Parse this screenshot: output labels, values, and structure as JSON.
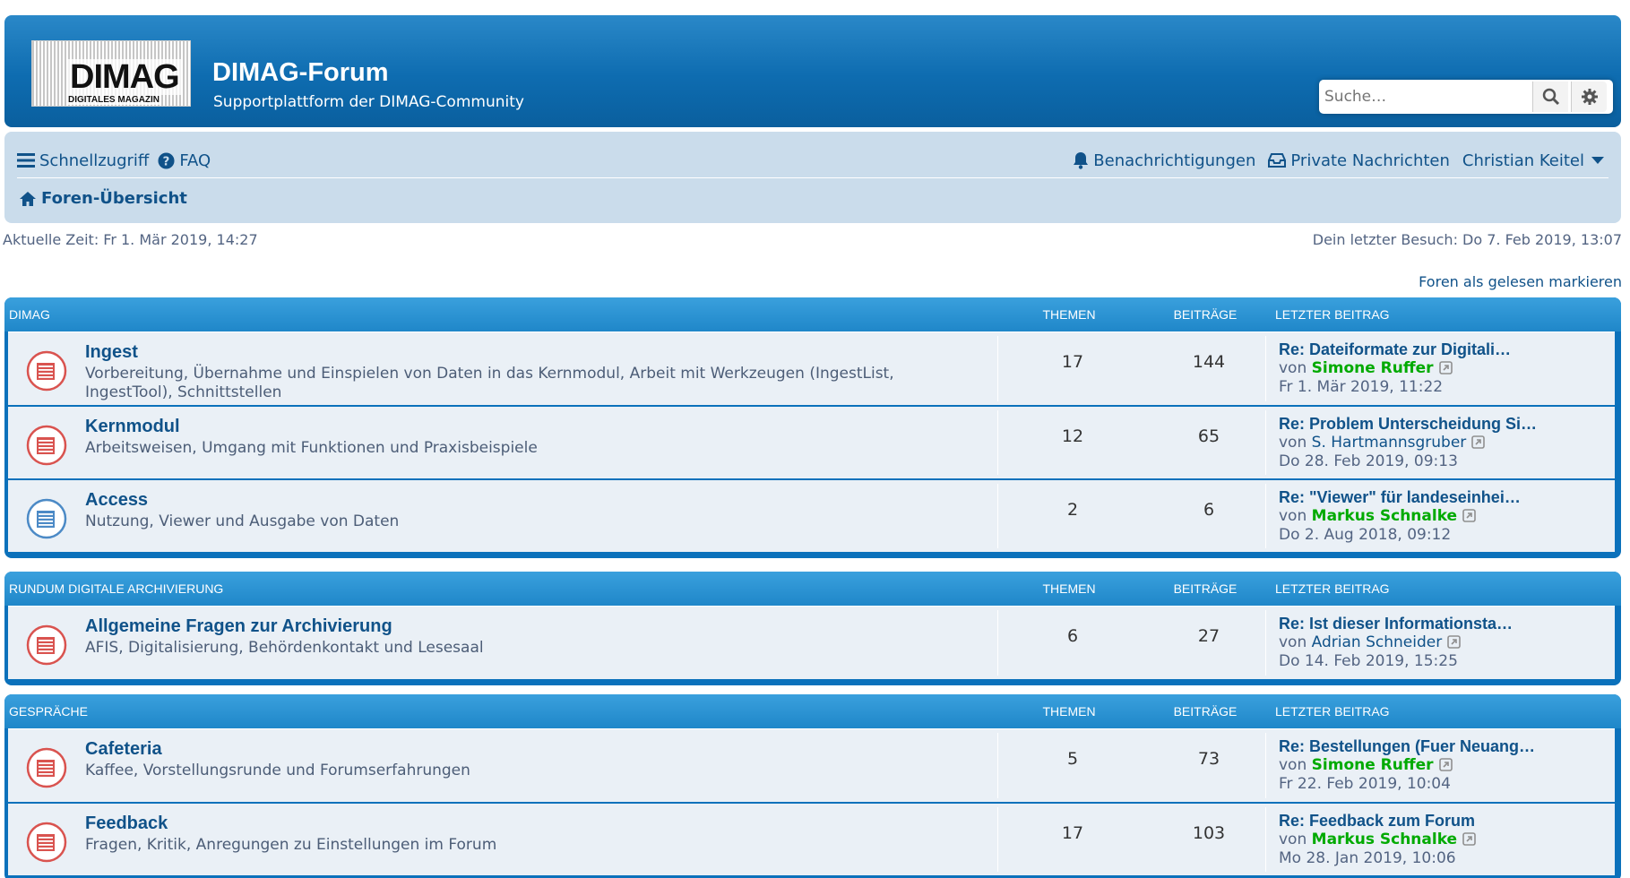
{
  "header": {
    "logo_text": "DIMAG",
    "logo_subtext": "DIGITALES MAGAZIN",
    "title": "DIMAG-Forum",
    "description": "Supportplattform der DIMAG-Community",
    "search_placeholder": "Suche…"
  },
  "nav": {
    "quick_access": "Schnellzugriff",
    "faq": "FAQ",
    "notifications": "Benachrichtigungen",
    "messages": "Private Nachrichten",
    "user": "Christian Keitel",
    "breadcrumb": "Foren-Übersicht"
  },
  "info": {
    "current_time": "Aktuelle Zeit: Fr 1. Mär 2019, 14:27",
    "last_visit": "Dein letzter Besuch: Do 7. Feb 2019, 13:07",
    "mark_read": "Foren als gelesen markieren"
  },
  "columns": {
    "topics": "THEMEN",
    "posts": "BEITRÄGE",
    "last": "LETZTER BEITRAG"
  },
  "categories": [
    {
      "name": "DIMAG",
      "forums": [
        {
          "name": "Ingest",
          "desc": "Vorbereitung, Übernahme und Einspielen von Daten in das Kernmodul, Arbeit mit Werkzeugen (IngestList, IngestTool), Schnittstellen",
          "topics": "17",
          "posts": "144",
          "last_title": "Re: Dateiformate zur Digitali…",
          "by": "von",
          "author": "Simone Ruffer",
          "author_color": "green",
          "date": "Fr 1. Mär 2019, 11:22",
          "icon": "red"
        },
        {
          "name": "Kernmodul",
          "desc": "Arbeitsweisen, Umgang mit Funktionen und Praxisbeispiele",
          "topics": "12",
          "posts": "65",
          "last_title": "Re: Problem Unterscheidung Si…",
          "by": "von",
          "author": "S. Hartmannsgruber",
          "author_color": "default",
          "date": "Do 28. Feb 2019, 09:13",
          "icon": "red"
        },
        {
          "name": "Access",
          "desc": "Nutzung, Viewer und Ausgabe von Daten",
          "topics": "2",
          "posts": "6",
          "last_title": "Re: \"Viewer\" für landeseinhei…",
          "by": "von",
          "author": "Markus Schnalke",
          "author_color": "green",
          "date": "Do 2. Aug 2018, 09:12",
          "icon": "blue"
        }
      ]
    },
    {
      "name": "RUNDUM DIGITALE ARCHIVIERUNG",
      "forums": [
        {
          "name": "Allgemeine Fragen zur Archivierung",
          "desc": "AFIS, Digitalisierung, Behördenkontakt und Lesesaal",
          "topics": "6",
          "posts": "27",
          "last_title": "Re: Ist dieser Informationsta…",
          "by": "von",
          "author": "Adrian Schneider",
          "author_color": "default",
          "date": "Do 14. Feb 2019, 15:25",
          "icon": "red"
        }
      ]
    },
    {
      "name": "GESPRÄCHE",
      "forums": [
        {
          "name": "Cafeteria",
          "desc": "Kaffee, Vorstellungsrunde und Forumserfahrungen",
          "topics": "5",
          "posts": "73",
          "last_title": "Re: Bestellungen (Fuer Neuang…",
          "by": "von",
          "author": "Simone Ruffer",
          "author_color": "green",
          "date": "Fr 22. Feb 2019, 10:04",
          "icon": "red"
        },
        {
          "name": "Feedback",
          "desc": "Fragen, Kritik, Anregungen zu Einstellungen im Forum",
          "topics": "17",
          "posts": "103",
          "last_title": "Re: Feedback zum Forum",
          "by": "von",
          "author": "Markus Schnalke",
          "author_color": "green",
          "date": "Mo 28. Jan 2019, 10:06",
          "icon": "red"
        }
      ]
    }
  ],
  "colors": {
    "brand": "#0b71bb",
    "link": "#105289",
    "unread_icon": "#d9534f",
    "read_icon": "#4c8ac6",
    "online_author": "#00aa00"
  }
}
